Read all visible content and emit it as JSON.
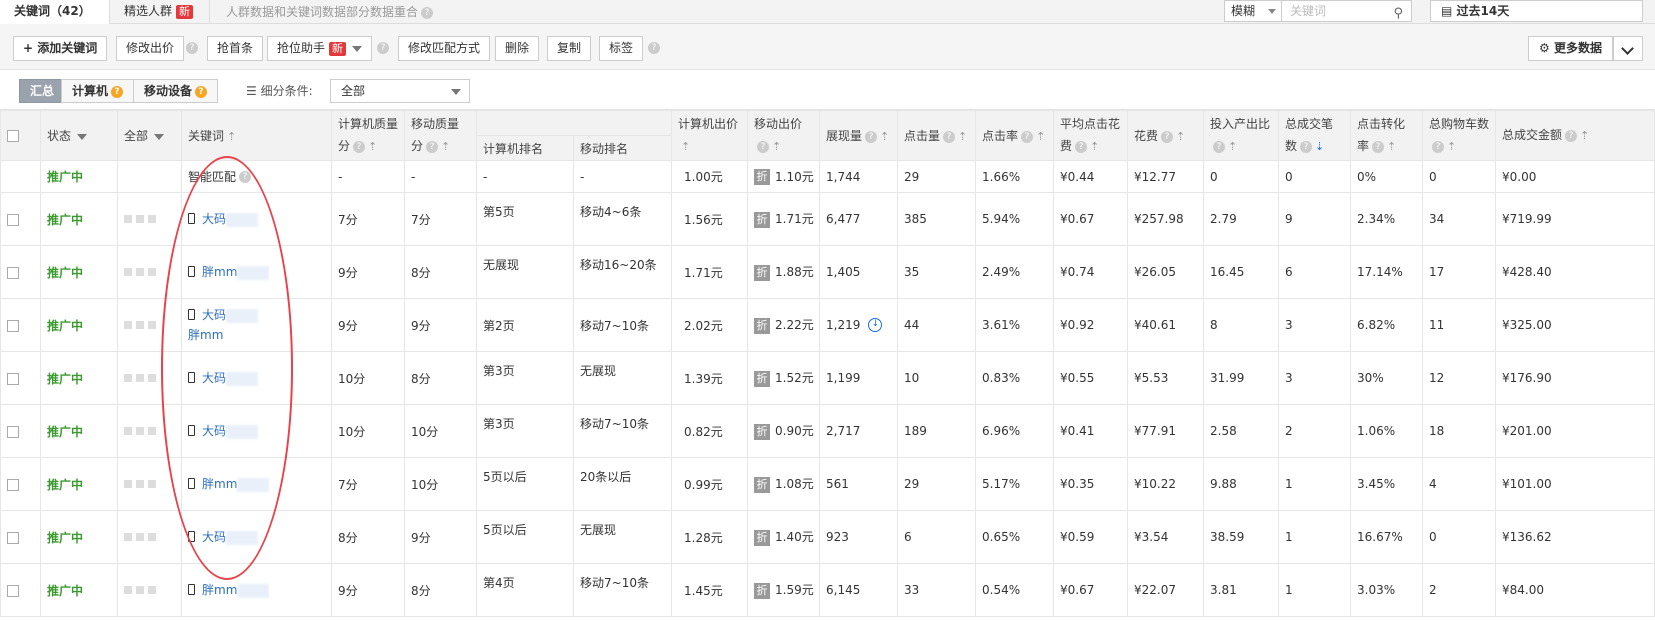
{
  "tabs": {
    "keywords_label": "关键词（42）",
    "crowd_label": "精选人群",
    "new_badge": "新",
    "tip": "人群数据和关键词数据部分数据重合"
  },
  "search": {
    "match_mode": "模糊",
    "placeholder": "关键词"
  },
  "date_range": "过去14天",
  "toolbar": {
    "add_keyword": "添加关键词",
    "edit_bid": "修改出价",
    "grab_top": "抢首条",
    "grab_assistant": "抢位助手",
    "edit_match": "修改匹配方式",
    "delete": "删除",
    "copy": "复制",
    "tag": "标签",
    "more_data": "更多数据"
  },
  "filter": {
    "summary": "汇总",
    "computer": "计算机",
    "mobile": "移动设备",
    "condition_label": "细分条件:",
    "condition_value": "全部"
  },
  "columns": {
    "status": "状态",
    "all": "全部",
    "keyword": "关键词",
    "pc_quality": "计算机质量分",
    "mobile_quality": "移动质量分",
    "pc_rank": "计算机排名",
    "mobile_rank": "移动排名",
    "pc_bid": "计算机出价",
    "mobile_bid": "移动出价",
    "impressions": "展现量",
    "clicks": "点击量",
    "ctr": "点击率",
    "avg_cpc": "平均点击花费",
    "cost": "花费",
    "roi": "投入产出比",
    "conversions": "总成交笔数",
    "conv_rate": "点击转化率",
    "carts": "总购物车数",
    "gmv": "总成交金额"
  },
  "icons": {
    "sort": "sort-arrow-icon",
    "help": "question-icon",
    "device": "phone-icon",
    "discount": "zhe-icon"
  },
  "discount_label": "折",
  "rows": [
    {
      "status": "推广中",
      "keyword": "智能匹配",
      "pc_quality": "-",
      "mobile_quality": "-",
      "pc_rank": "-",
      "mobile_rank": "-",
      "pc_bid": "1.00元",
      "mobile_bid": "1.10元",
      "impressions": "1,744",
      "clicks": "29",
      "ctr": "1.66%",
      "avg_cpc": "¥0.44",
      "cost": "¥12.77",
      "roi": "0",
      "conversions": "0",
      "conv_rate": "0%",
      "carts": "0",
      "gmv": "¥0.00"
    },
    {
      "status": "推广中",
      "keyword": "大码",
      "pc_quality": "7分",
      "mobile_quality": "7分",
      "pc_rank": "第5页",
      "mobile_rank": "移动4~6条",
      "pc_bid": "1.56元",
      "mobile_bid": "1.71元",
      "impressions": "6,477",
      "clicks": "385",
      "ctr": "5.94%",
      "avg_cpc": "¥0.67",
      "cost": "¥257.98",
      "roi": "2.79",
      "conversions": "9",
      "conv_rate": "2.34%",
      "carts": "34",
      "gmv": "¥719.99"
    },
    {
      "status": "推广中",
      "keyword": "胖mm",
      "pc_quality": "9分",
      "mobile_quality": "8分",
      "pc_rank": "无展现",
      "mobile_rank": "移动16~20条",
      "pc_bid": "1.71元",
      "mobile_bid": "1.88元",
      "impressions": "1,405",
      "clicks": "35",
      "ctr": "2.49%",
      "avg_cpc": "¥0.74",
      "cost": "¥26.05",
      "roi": "16.45",
      "conversions": "6",
      "conv_rate": "17.14%",
      "carts": "17",
      "gmv": "¥428.40"
    },
    {
      "status": "推广中",
      "keyword": "大码",
      "keyword2": "胖mm",
      "pc_quality": "9分",
      "mobile_quality": "9分",
      "pc_rank": "第2页",
      "mobile_rank": "移动7~10条",
      "pc_bid": "2.02元",
      "mobile_bid": "2.22元",
      "impressions": "1,219",
      "clicks": "44",
      "ctr": "3.61%",
      "avg_cpc": "¥0.92",
      "cost": "¥40.61",
      "roi": "8",
      "conversions": "3",
      "conv_rate": "6.82%",
      "carts": "11",
      "gmv": "¥325.00"
    },
    {
      "status": "推广中",
      "keyword": "大码",
      "pc_quality": "10分",
      "mobile_quality": "8分",
      "pc_rank": "第3页",
      "mobile_rank": "无展现",
      "pc_bid": "1.39元",
      "mobile_bid": "1.52元",
      "impressions": "1,199",
      "clicks": "10",
      "ctr": "0.83%",
      "avg_cpc": "¥0.55",
      "cost": "¥5.53",
      "roi": "31.99",
      "conversions": "3",
      "conv_rate": "30%",
      "carts": "12",
      "gmv": "¥176.90"
    },
    {
      "status": "推广中",
      "keyword": "大码",
      "pc_quality": "10分",
      "mobile_quality": "10分",
      "pc_rank": "第3页",
      "mobile_rank": "移动7~10条",
      "pc_bid": "0.82元",
      "mobile_bid": "0.90元",
      "impressions": "2,717",
      "clicks": "189",
      "ctr": "6.96%",
      "avg_cpc": "¥0.41",
      "cost": "¥77.91",
      "roi": "2.58",
      "conversions": "2",
      "conv_rate": "1.06%",
      "carts": "18",
      "gmv": "¥201.00"
    },
    {
      "status": "推广中",
      "keyword": "胖mm",
      "pc_quality": "7分",
      "mobile_quality": "10分",
      "pc_rank": "5页以后",
      "mobile_rank": "20条以后",
      "pc_bid": "0.99元",
      "mobile_bid": "1.08元",
      "impressions": "561",
      "clicks": "29",
      "ctr": "5.17%",
      "avg_cpc": "¥0.35",
      "cost": "¥10.22",
      "roi": "9.88",
      "conversions": "1",
      "conv_rate": "3.45%",
      "carts": "4",
      "gmv": "¥101.00"
    },
    {
      "status": "推广中",
      "keyword": "大码",
      "pc_quality": "8分",
      "mobile_quality": "9分",
      "pc_rank": "5页以后",
      "mobile_rank": "无展现",
      "pc_bid": "1.28元",
      "mobile_bid": "1.40元",
      "impressions": "923",
      "clicks": "6",
      "ctr": "0.65%",
      "avg_cpc": "¥0.59",
      "cost": "¥3.54",
      "roi": "38.59",
      "conversions": "1",
      "conv_rate": "16.67%",
      "carts": "0",
      "gmv": "¥136.62"
    },
    {
      "status": "推广中",
      "keyword": "胖mm",
      "pc_quality": "9分",
      "mobile_quality": "8分",
      "pc_rank": "第4页",
      "mobile_rank": "移动7~10条",
      "pc_bid": "1.45元",
      "mobile_bid": "1.59元",
      "impressions": "6,145",
      "clicks": "33",
      "ctr": "0.54%",
      "avg_cpc": "¥0.67",
      "cost": "¥22.07",
      "roi": "3.81",
      "conversions": "1",
      "conv_rate": "3.03%",
      "carts": "2",
      "gmv": "¥84.00"
    }
  ]
}
